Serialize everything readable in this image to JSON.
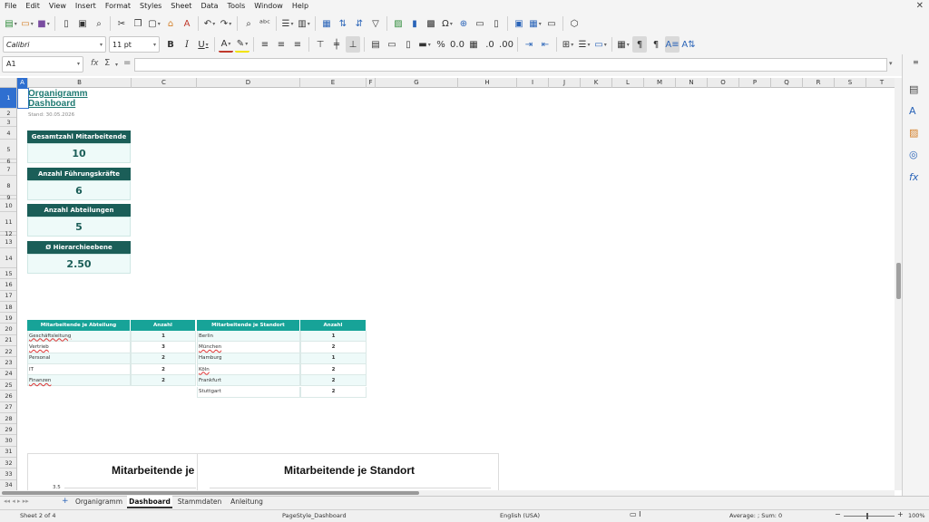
{
  "menubar": {
    "items": [
      "File",
      "Edit",
      "View",
      "Insert",
      "Format",
      "Styles",
      "Sheet",
      "Data",
      "Tools",
      "Window",
      "Help"
    ],
    "close_glyph": "✕"
  },
  "toolbar": {
    "font_name": "Calibri",
    "font_size": "11 pt"
  },
  "formula_bar": {
    "cell_ref": "A1",
    "fx_glyph": "fx",
    "sum_glyph": "Σ",
    "equals_glyph": "=",
    "content": ""
  },
  "columns": [
    "A",
    "B",
    "C",
    "D",
    "E",
    "F",
    "G",
    "H",
    "I",
    "J",
    "K",
    "L",
    "M",
    "N",
    "O",
    "P",
    "Q",
    "R",
    "S",
    "T"
  ],
  "rows": [
    "1",
    "2",
    "3",
    "4",
    "5",
    "6",
    "7",
    "8",
    "9",
    "10",
    "11",
    "12",
    "13",
    "14",
    "15",
    "16",
    "17",
    "18",
    "19",
    "20",
    "21",
    "22",
    "23",
    "24",
    "25",
    "26",
    "27",
    "28",
    "29",
    "30",
    "31",
    "32",
    "33",
    "34"
  ],
  "dashboard": {
    "title_line1": "Organigramm",
    "title_line2": "Dashboard",
    "stand": "Stand: 30.05.2026",
    "kpis": [
      {
        "label": "Gesamtzahl Mitarbeitende",
        "value": "10"
      },
      {
        "label": "Anzahl Führungskräfte",
        "value": "6"
      },
      {
        "label": "Anzahl Abteilungen",
        "value": "5"
      },
      {
        "label": "Ø Hierarchieebene",
        "value": "2.50"
      }
    ],
    "dept_table": {
      "headers": [
        "Mitarbeitende je Abteilung",
        "Anzahl"
      ],
      "rows": [
        {
          "name": "Geschäftsleitung",
          "count": "1"
        },
        {
          "name": "Vertrieb",
          "count": "3"
        },
        {
          "name": "Personal",
          "count": "2"
        },
        {
          "name": "IT",
          "count": "2"
        },
        {
          "name": "Finanzen",
          "count": "2"
        }
      ]
    },
    "loc_table": {
      "headers": [
        "Mitarbeitende je Standort",
        "Anzahl"
      ],
      "rows": [
        {
          "name": "Berlin",
          "count": "1"
        },
        {
          "name": "München",
          "count": "2"
        },
        {
          "name": "Hamburg",
          "count": "1"
        },
        {
          "name": "Köln",
          "count": "2"
        },
        {
          "name": "Frankfurt",
          "count": "2"
        },
        {
          "name": "Stuttgart",
          "count": "2"
        }
      ]
    },
    "chart1_title": "Mitarbeitende je",
    "chart2_title": "Mitarbeitende je Standort",
    "chart1_axis_tick": "3.5"
  },
  "tabs": {
    "add_glyph": "+",
    "items": [
      "Organigramm",
      "Dashboard",
      "Stammdaten",
      "Anleitung"
    ],
    "active": "Dashboard"
  },
  "status": {
    "sheet": "Sheet 2 of 4",
    "page_style": "PageStyle_Dashboard",
    "language": "English (USA)",
    "stats": "Average: ; Sum: 0",
    "zoom": "100%"
  }
}
